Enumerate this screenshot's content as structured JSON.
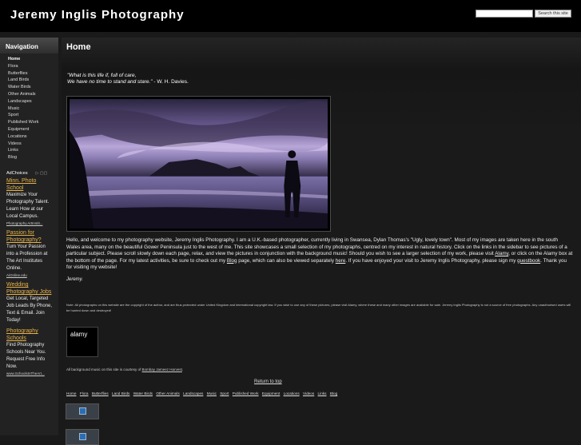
{
  "header": {
    "title": "Jeremy Inglis Photography",
    "search_placeholder": "",
    "search_button": "Search this site"
  },
  "sidebar": {
    "heading": "Navigation",
    "items": [
      {
        "label": "Home"
      },
      {
        "label": "Flora"
      },
      {
        "label": "Butterflies"
      },
      {
        "label": "Land Birds"
      },
      {
        "label": "Water Birds"
      },
      {
        "label": "Other Animals"
      },
      {
        "label": "Landscapes"
      },
      {
        "label": "Music"
      },
      {
        "label": "Sport"
      },
      {
        "label": "Published Work"
      },
      {
        "label": "Equipment"
      },
      {
        "label": "Locations"
      },
      {
        "label": "Videos"
      },
      {
        "label": "Links"
      },
      {
        "label": "Blog"
      }
    ],
    "adchoices": "AdChoices",
    "ads": [
      {
        "title": "Minn. Photo School",
        "text": "Maximize Your Photography Talent. Learn How at our Local Campus.",
        "url": "Photography.ArtInstit..."
      },
      {
        "title": "Passion for Photography?",
        "text": "Turn Your Passion into a Profession at The Art Institutes Online.",
        "url": "AiOnline.edu"
      },
      {
        "title": "Wedding Photography Jobs",
        "text": "Get Local, Targeted Job Leads By Phone, Text & Email. Join Today!",
        "url": ""
      },
      {
        "title": "Photography Schools",
        "text": "Find Photography Schools Near You. Request Free Info Now.",
        "url": "www.SchoolsInTheArt..."
      }
    ]
  },
  "main": {
    "title": "Home",
    "quote_line1": "\"What is this life if, full of care,",
    "quote_line2": "We have no time to stand and stare.\"",
    "quote_attr": " - W. H. Davies.",
    "intro_part1": "Hello, and welcome to my photography website, Jeremy Inglis Photography. I am a U.K.-based photographer, currently living in Swansea, Dylan Thomas's \"Ugly, lovely town\". Most of my images are taken here in the south Wales area, many on the beautiful Gower Peninsula just to the west of me. This site showcases a small selection of my photographs, centred on my interest in natural history. Click on the links in the sidebar to see pictures of a particular subject. Please scroll slowly down each page, relax, and view the pictures in conjunction with the background music! Should you wish to see a larger selection of my work, please visit ",
    "alamy_link": "Alamy",
    "intro_part2": ", or click on the Alamy box at the bottom of the page. For my latest activities, be sure to check out my ",
    "blog_link": "Blog",
    "intro_part3": " page, which can also be viewed separately ",
    "here_link": "here",
    "intro_part4": ". If you have enjoyed your visit to Jeremy Inglis Photography, please sign my ",
    "guestbook_link": "guestbook",
    "intro_part5": ". Thank you for visiting my website!",
    "signoff": "Jeremy.",
    "note": "Note: All photographs on this website are the copyright of the author, and are thus protected under United Kingdom and international copyright law. If you wish to use any of these pictures, please visit Alamy, where these and many other images are available for sale. Jeremy Inglis Photography is not a source of free photographs. Any unauthorised users will be hunted down and destroyed!",
    "alamy_box_label": "alamy",
    "music_credit_prefix": "All background music on this site is courtesy of ",
    "music_credit_link": "Bombay Jameez Harvest",
    "music_credit_suffix": ".",
    "return_top": "Return to top",
    "footer_links": [
      "Home",
      "Flora",
      "Butterflies",
      "Land Birds",
      "Water Birds",
      "Other Animals",
      "Landscapes",
      "Music",
      "Sport",
      "Published Work",
      "Equipment",
      "Locations",
      "Videos",
      "Links",
      "Blog"
    ]
  },
  "colors": {
    "accent_link": "#e8b34a",
    "background": "#1a1a1a",
    "header_bg": "#000000"
  }
}
